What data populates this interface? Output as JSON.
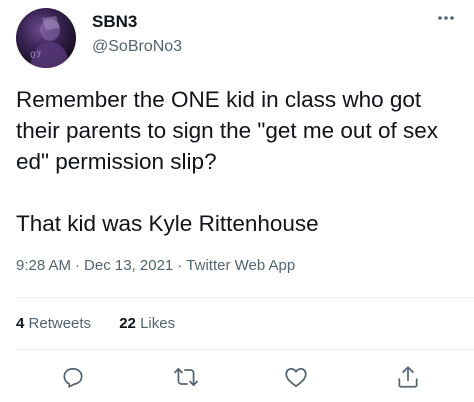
{
  "author": {
    "display_name": "SBN3",
    "handle": "@SoBroNo3",
    "avatar_text": "07"
  },
  "tweet": {
    "text": "Remember the ONE kid in class who got their parents to sign the \"get me out of sex ed\" permission slip?\n\nThat kid was Kyle Rittenhouse",
    "time": "9:28 AM",
    "date": "Dec 13, 2021",
    "source": "Twitter Web App",
    "separator": "·"
  },
  "stats": {
    "retweets_count": "4",
    "retweets_label": "Retweets",
    "likes_count": "22",
    "likes_label": "Likes"
  },
  "actions": [
    "reply-icon",
    "retweet-icon",
    "like-icon",
    "share-icon"
  ],
  "colors": {
    "text": "#0f1419",
    "secondary": "#536471",
    "divider": "#eff3f4"
  }
}
